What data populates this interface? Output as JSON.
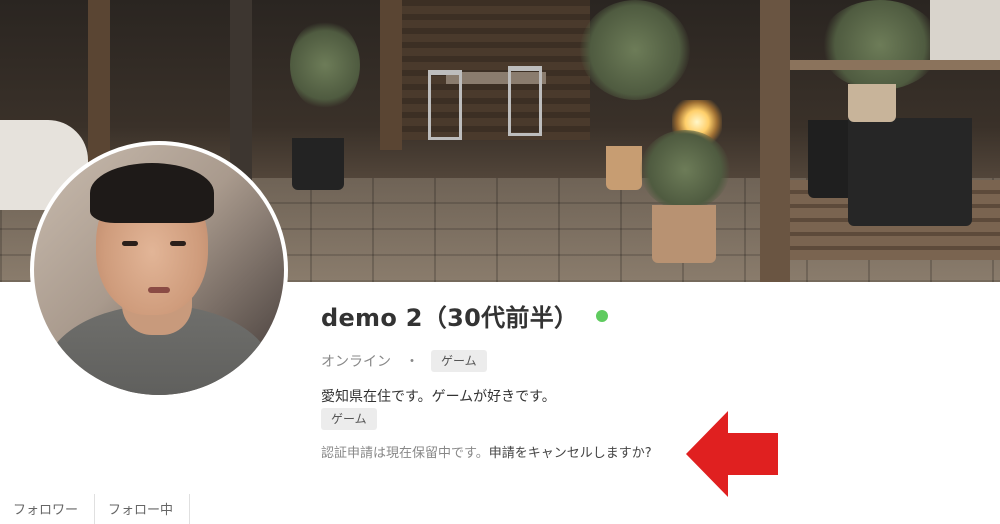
{
  "profile": {
    "name": "demo 2（30代前半）",
    "online_color": "#5fcb5f",
    "status": "オンライン",
    "separator": "・",
    "status_tag": "ゲーム",
    "bio": "愛知県在住です。ゲームが好きです。",
    "interest_tag": "ゲーム",
    "verify_text": "認証申請は現在保留中です。",
    "verify_cancel_link": "申請をキャンセルしますか?"
  },
  "stats": [
    {
      "label": "フォロワー"
    },
    {
      "label": "フォロー中"
    }
  ],
  "annotation": {
    "arrow_color": "#e02020"
  }
}
